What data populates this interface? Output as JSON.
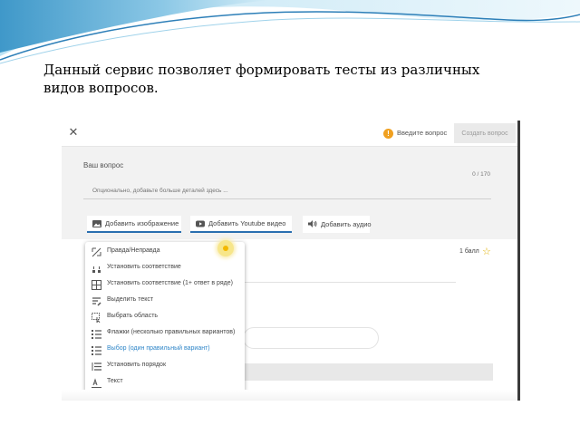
{
  "slide": {
    "text": "Данный сервис позволяет формировать тесты из различных видов вопросов."
  },
  "topbar": {
    "close_symbol": "✕",
    "warning_text": "Введите вопрос",
    "create_button": "Создать вопрос"
  },
  "question": {
    "title": "Ваш вопрос",
    "counter": "0 / 170",
    "input_placeholder": "Опционально, добавьте больше деталей здесь ..."
  },
  "media_buttons": {
    "image": "Добавить изображение",
    "video": "Добавить Youtube видео",
    "audio": "Добавить аудио"
  },
  "answers": {
    "points": "1 балл"
  },
  "type_menu": {
    "items": [
      {
        "label": "Правда/Неправда",
        "icon": "true-false-icon"
      },
      {
        "label": "Установить соответствие",
        "icon": "match-icon"
      },
      {
        "label": "Установить соответствие (1+ ответ в ряде)",
        "icon": "match-multi-icon"
      },
      {
        "label": "Выделить текст",
        "icon": "highlight-text-icon"
      },
      {
        "label": "Выбрать область",
        "icon": "select-area-icon"
      },
      {
        "label": "Флажки (несколько правильных вариантов)",
        "icon": "checkboxes-icon"
      },
      {
        "label": "Выбор (один правильный вариант)",
        "icon": "single-choice-icon",
        "selected": true
      },
      {
        "label": "Установить порядок",
        "icon": "order-icon"
      },
      {
        "label": "Текст",
        "icon": "text-icon"
      }
    ]
  },
  "colors": {
    "accent": "#2a6fb0",
    "selected_item": "#2f86c8",
    "warning": "#f0a020",
    "star": "#e0b000"
  }
}
